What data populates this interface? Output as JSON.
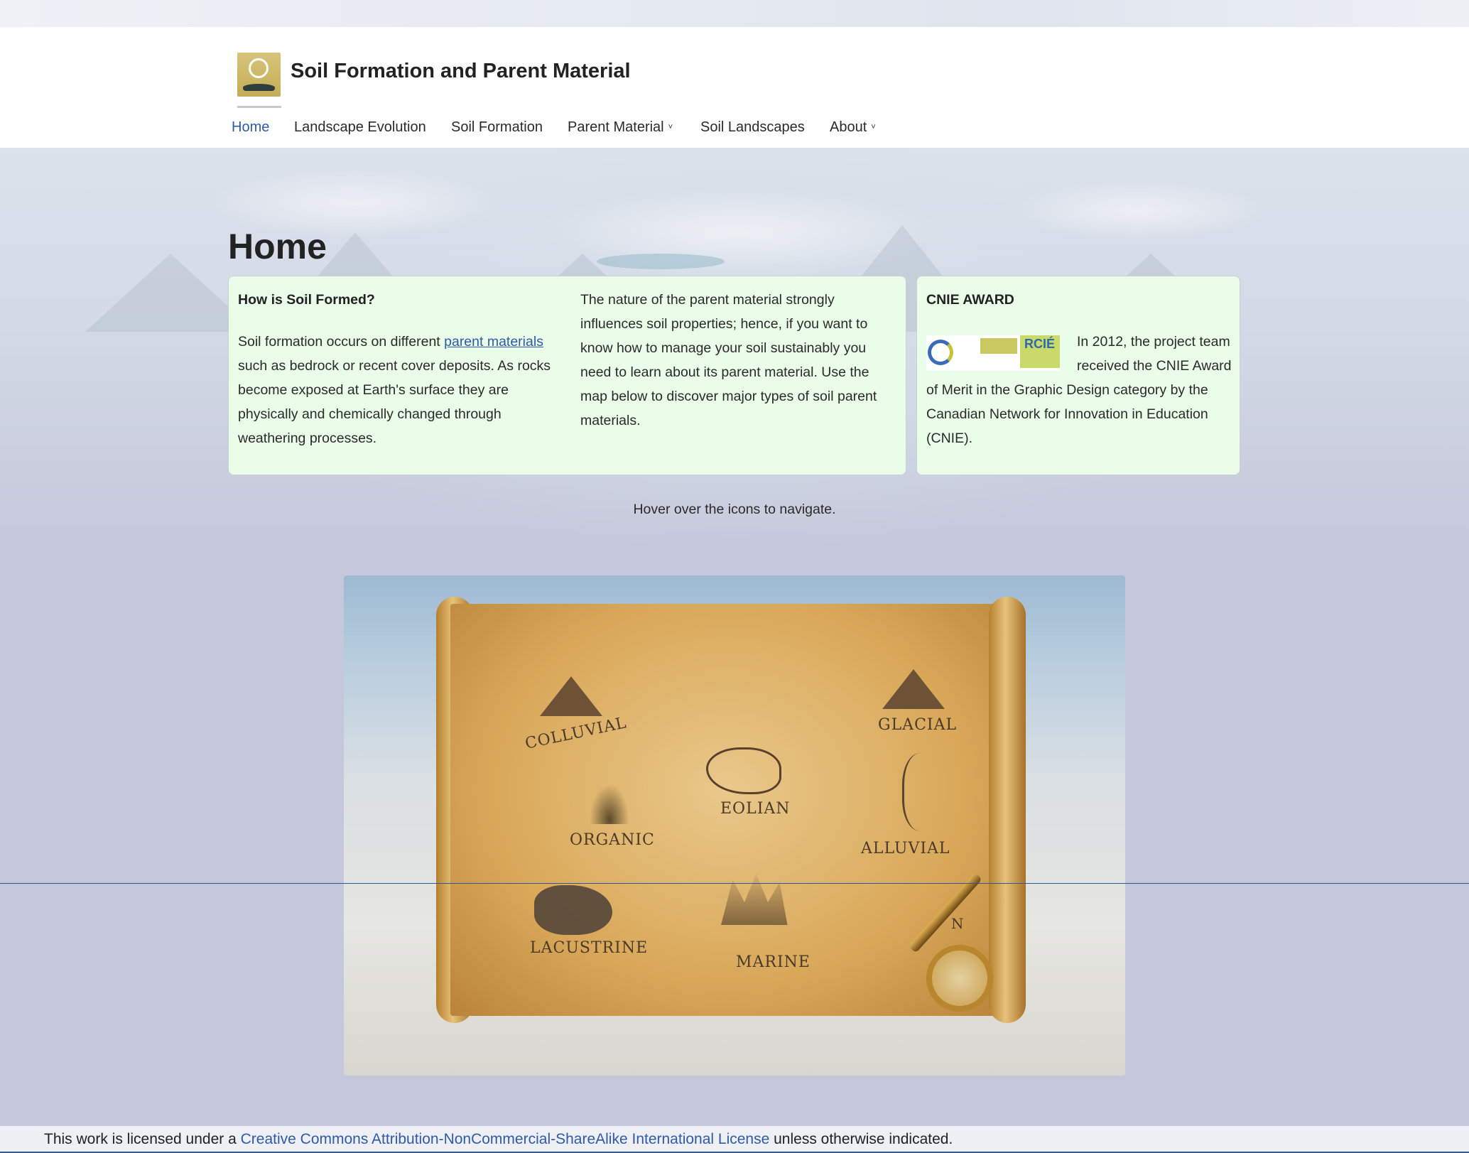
{
  "site": {
    "title": "Soil Formation and Parent Material",
    "logo_name": "site-logo"
  },
  "nav": {
    "items": [
      {
        "label": "Home",
        "active": true,
        "has_dropdown": false
      },
      {
        "label": "Landscape Evolution",
        "active": false,
        "has_dropdown": false
      },
      {
        "label": "Soil Formation",
        "active": false,
        "has_dropdown": false
      },
      {
        "label": "Parent Material",
        "active": false,
        "has_dropdown": true
      },
      {
        "label": "Soil Landscapes",
        "active": false,
        "has_dropdown": false
      },
      {
        "label": "About",
        "active": false,
        "has_dropdown": true
      }
    ],
    "caret": "˅"
  },
  "page": {
    "title": "Home"
  },
  "intro": {
    "heading": "How is Soil Formed?",
    "p1_before": "Soil formation occurs on different ",
    "p1_link": "parent materials",
    "p1_after": " such as bedrock or recent cover deposits. As rocks become exposed at Earth's surface they are physically and chemically changed through weathering processes.",
    "p2": "The nature of the parent material strongly influences soil properties; hence, if you want to know how to manage your soil sustainably you need to learn about its parent material. Use the map below to discover major types of soil parent materials."
  },
  "award": {
    "heading": "CNIE AWARD",
    "logo_text": "RCIÉ",
    "text": "In 2012, the project team received the CNIE Award of Merit in the Graphic Design category by the Canadian Network for Innovation in Education (CNIE)."
  },
  "map": {
    "hint": "Hover over the icons to navigate.",
    "labels": {
      "colluvial": "COLLUVIAL",
      "glacial": "GLACIAL",
      "eolian": "EOLIAN",
      "organic": "ORGANIC",
      "alluvial": "ALLUVIAL",
      "lacustrine": "LACUSTRINE",
      "marine": "MARINE",
      "compass_n": "N"
    }
  },
  "footer": {
    "before": "This work is licensed under a ",
    "link": "Creative Commons Attribution-NonCommercial-ShareAlike International License",
    "after": " unless otherwise indicated."
  },
  "colors": {
    "accent": "#2f5aa8",
    "card_bg": "#eafde9",
    "page_bg": "#c5c8db"
  }
}
